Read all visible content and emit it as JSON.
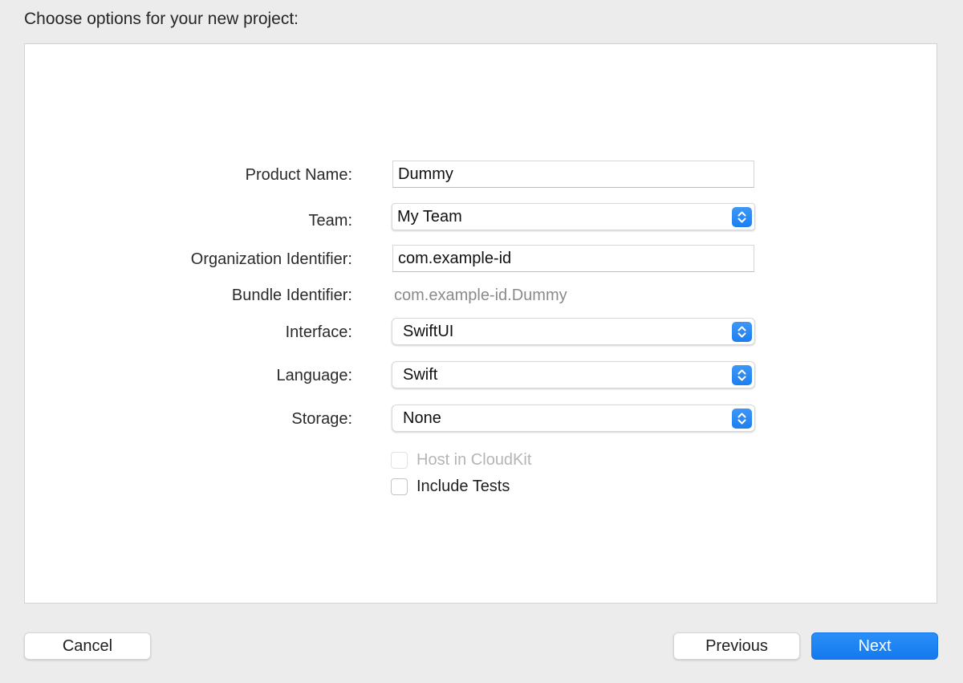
{
  "dialog": {
    "heading": "Choose options for your new project:"
  },
  "form": {
    "product_name": {
      "label": "Product Name:",
      "value": "Dummy"
    },
    "team": {
      "label": "Team:",
      "value": "My Team"
    },
    "organization_identifier": {
      "label": "Organization Identifier:",
      "value": "com.example-id"
    },
    "bundle_identifier": {
      "label": "Bundle Identifier:",
      "value": "com.example-id.Dummy"
    },
    "interface": {
      "label": "Interface:",
      "value": "SwiftUI"
    },
    "language": {
      "label": "Language:",
      "value": "Swift"
    },
    "storage": {
      "label": "Storage:",
      "value": "None"
    },
    "host_in_cloudkit": {
      "label": "Host in CloudKit",
      "checked": false,
      "enabled": false
    },
    "include_tests": {
      "label": "Include Tests",
      "checked": false,
      "enabled": true
    }
  },
  "buttons": {
    "cancel": "Cancel",
    "previous": "Previous",
    "next": "Next"
  },
  "colors": {
    "accent": "#1d7ff0",
    "panel_bg": "#ffffff",
    "window_bg": "#ececec"
  },
  "icons": {
    "popup_indicator": "chevron-up-down-icon"
  }
}
